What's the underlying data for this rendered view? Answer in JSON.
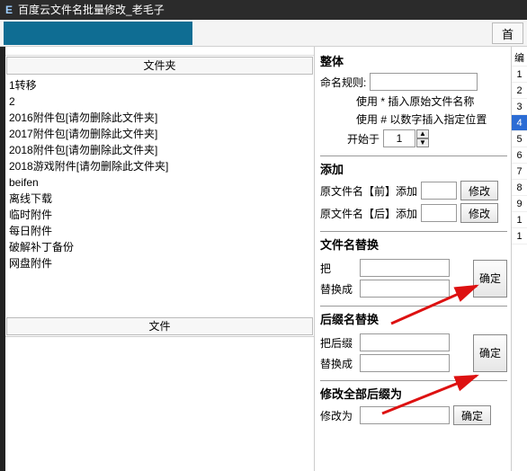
{
  "titlebar": {
    "e": "E",
    "title": "百度云文件名批量修改_老毛子"
  },
  "toolbar": {
    "right_btn": "首"
  },
  "left": {
    "folder_header": "文件夹",
    "file_header": "文件",
    "folders": [
      "1转移",
      "2",
      "2016附件包[请勿删除此文件夹]",
      "2017附件包[请勿删除此文件夹]",
      "2018附件包[请勿删除此文件夹]",
      "2018游戏附件[请勿删除此文件夹]",
      "beifen",
      "离线下载",
      "临时附件",
      "每日附件",
      "破解补丁备份",
      "网盘附件"
    ]
  },
  "right": {
    "whole": {
      "title": "整体",
      "rule_label": "命名规则:",
      "hint1": "使用 * 插入原始文件名称",
      "hint2": "使用 # 以数字插入指定位置",
      "start_label": "开始于",
      "start_value": "1"
    },
    "add": {
      "title": "添加",
      "before": "原文件名【前】添加",
      "after": "原文件名【后】添加",
      "modify": "修改"
    },
    "replace": {
      "title": "文件名替换",
      "from": "把",
      "to": "替换成",
      "ok": "确定"
    },
    "ext_replace": {
      "title": "后缀名替换",
      "from": "把后缀",
      "to": "替换成",
      "ok": "确定"
    },
    "ext_all": {
      "title": "修改全部后缀为",
      "label": "修改为",
      "ok": "确定"
    }
  },
  "edge": [
    "编",
    "1",
    "2",
    "3",
    "4",
    "5",
    "6",
    "7",
    "8",
    "9",
    "1",
    "1"
  ]
}
